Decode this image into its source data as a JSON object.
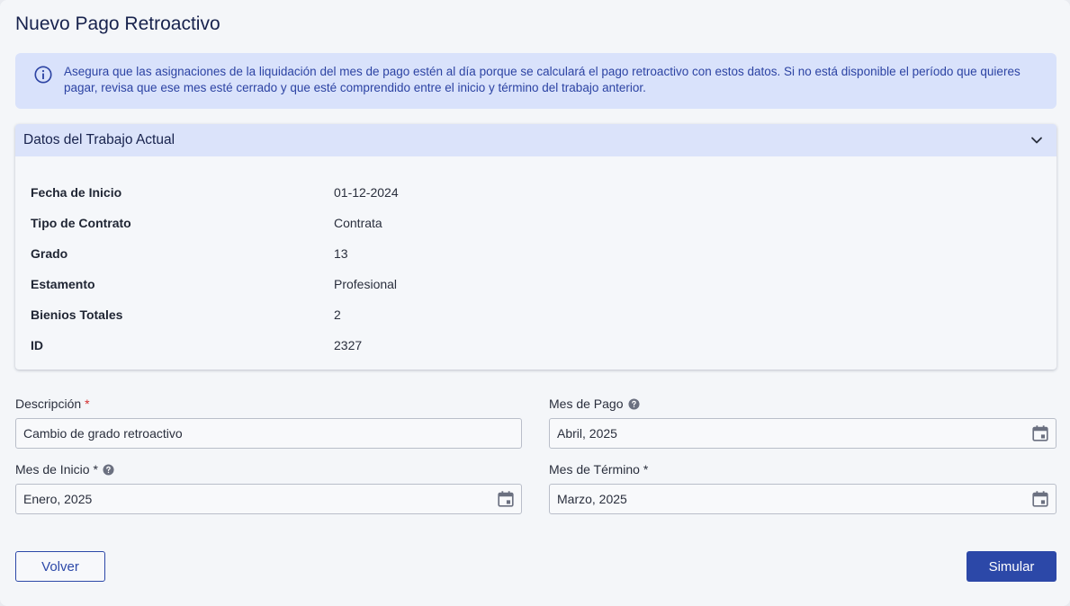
{
  "page": {
    "title": "Nuevo Pago Retroactivo"
  },
  "alert": {
    "icon": "info-icon",
    "text": "Asegura que las asignaciones de la liquidación del mes de pago estén al día porque se calculará el pago retroactivo con estos datos. Si no está disponible el período que quieres pagar, revisa que ese mes esté cerrado y que esté comprendido entre el inicio y término del trabajo anterior."
  },
  "job_card": {
    "title": "Datos del Trabajo Actual",
    "expanded": true,
    "rows": [
      {
        "label": "Fecha de Inicio",
        "value": "01-12-2024"
      },
      {
        "label": "Tipo de Contrato",
        "value": "Contrata"
      },
      {
        "label": "Grado",
        "value": "13"
      },
      {
        "label": "Estamento",
        "value": "Profesional"
      },
      {
        "label": "Bienios Totales",
        "value": "2"
      },
      {
        "label": "ID",
        "value": "2327"
      }
    ]
  },
  "form": {
    "descripcion": {
      "label": "Descripción",
      "required_mark": "*",
      "value": "Cambio de grado retroactivo"
    },
    "mes_pago": {
      "label": "Mes de Pago",
      "value": "Abril, 2025"
    },
    "mes_inicio": {
      "label": "Mes de Inicio",
      "required_mark": "*",
      "value": "Enero, 2025"
    },
    "mes_termino": {
      "label": "Mes de Término",
      "required_mark": "*",
      "value": "Marzo, 2025"
    }
  },
  "actions": {
    "back_label": "Volver",
    "simulate_label": "Simular"
  },
  "colors": {
    "primary": "#2c48a8",
    "alert_bg": "#d9e2fb",
    "required": "#d32f2f"
  }
}
